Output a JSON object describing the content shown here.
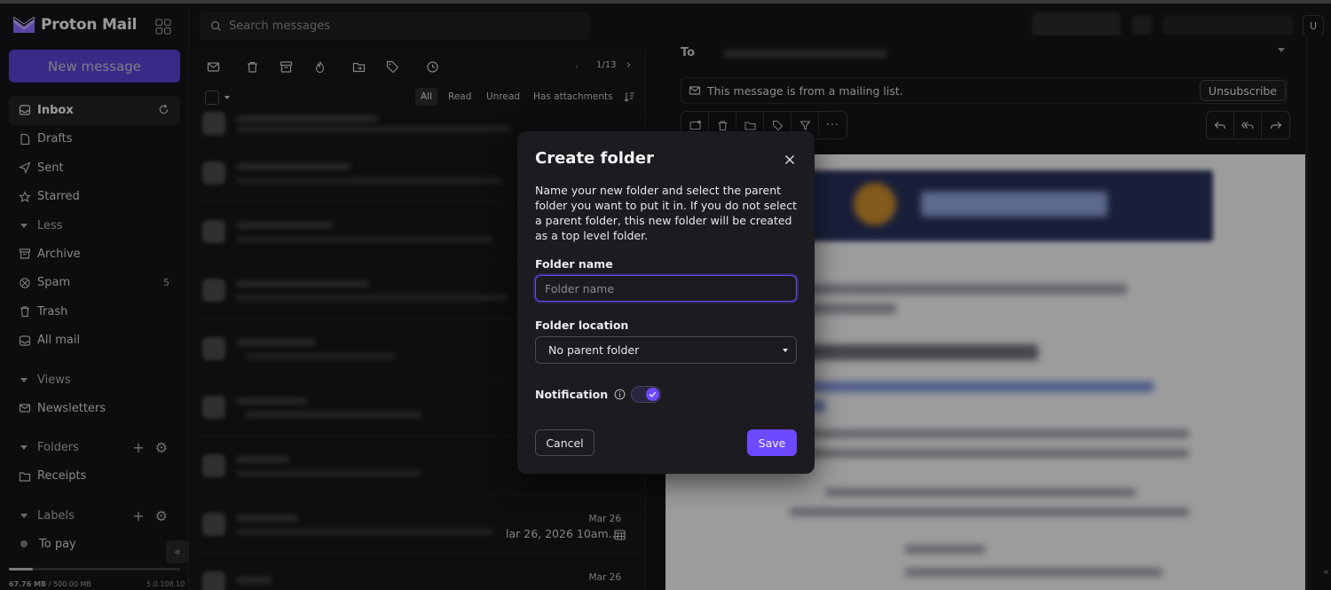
{
  "app": {
    "name": "Proton Mail"
  },
  "sidebar": {
    "new_message_label": "New message",
    "items": [
      {
        "label": "Inbox",
        "icon": "inbox-icon",
        "active": true
      },
      {
        "label": "Drafts",
        "icon": "drafts-icon"
      },
      {
        "label": "Sent",
        "icon": "sent-icon"
      },
      {
        "label": "Starred",
        "icon": "star-icon"
      }
    ],
    "less_label": "Less",
    "more_items": [
      {
        "label": "Archive",
        "icon": "archive-icon"
      },
      {
        "label": "Spam",
        "icon": "spam-icon",
        "count": "5"
      },
      {
        "label": "Trash",
        "icon": "trash-icon"
      },
      {
        "label": "All mail",
        "icon": "all-mail-icon"
      }
    ],
    "views_label": "Views",
    "newsletters_label": "Newsletters",
    "folders_label": "Folders",
    "receipts_label": "Receipts",
    "labels_label": "Labels",
    "to_pay_label": "To pay",
    "storage": {
      "used": "67.76 MB",
      "separator": " / ",
      "total": "500.00 MB",
      "fraction": 0.14
    },
    "version": "5.0.108.10"
  },
  "search": {
    "placeholder": "Search messages"
  },
  "user": {
    "initial": "U"
  },
  "list": {
    "pager": "1/13",
    "filters": {
      "all": "All",
      "read": "Read",
      "unread": "Unread",
      "attachments": "Has attachments"
    },
    "rows": [
      {
        "date": "Mar 26",
        "snippet": "lar 26, 2026 10am..."
      },
      {
        "date": "Mar 26"
      }
    ]
  },
  "reader": {
    "to_label": "To",
    "mailing_list_text": "This message is from a mailing list.",
    "unsubscribe_label": "Unsubscribe"
  },
  "modal": {
    "title": "Create folder",
    "description": "Name your new folder and select the parent folder you want to put it in. If you do not select a parent folder, this new folder will be created as a top level folder.",
    "folder_name_label": "Folder name",
    "folder_name_placeholder": "Folder name",
    "folder_location_label": "Folder location",
    "folder_location_value": "No parent folder",
    "notification_label": "Notification",
    "notification_on": true,
    "cancel_label": "Cancel",
    "save_label": "Save"
  },
  "colors": {
    "accent": "#6d4aff",
    "background": "#151517",
    "modal": "#1c1b20"
  }
}
